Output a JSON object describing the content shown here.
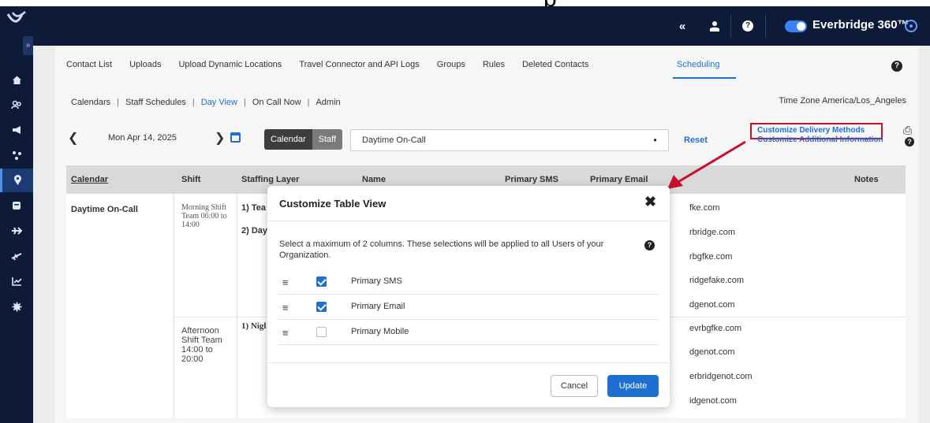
{
  "app": {
    "brand_name": "Everbridge 360™",
    "top_fragment": "p"
  },
  "topbar": {
    "collapse_label": "«",
    "help_label": "?"
  },
  "sidebar": {
    "expand_label": "»",
    "icons": [
      "home-icon",
      "contacts-icon",
      "megaphone-icon",
      "network-icon",
      "location-icon",
      "database-icon",
      "travel-icon",
      "flight-icon",
      "chart-icon",
      "settings-icon"
    ]
  },
  "tabs": [
    {
      "label": "Contact List"
    },
    {
      "label": "Uploads"
    },
    {
      "label": "Upload Dynamic Locations"
    },
    {
      "label": "Travel Connector and API Logs"
    },
    {
      "label": "Groups"
    },
    {
      "label": "Rules"
    },
    {
      "label": "Deleted Contacts"
    },
    {
      "label": "Scheduling"
    }
  ],
  "subnav": {
    "items": [
      "Calendars",
      "Staff Schedules",
      "Day View",
      "On Call Now",
      "Admin"
    ],
    "separator": "|",
    "time_zone": "Time Zone America/Los_Angeles"
  },
  "toolbar": {
    "date": "Mon Apr 14, 2025",
    "view_calendar": "Calendar",
    "view_staff": "Staff",
    "calendar_select": "Daytime On-Call",
    "reset": "Reset",
    "customize_delivery": "Customize Delivery Methods",
    "customize_additional": "Customize Additional Information"
  },
  "table": {
    "headers": {
      "calendar": "Calendar",
      "shift": "Shift",
      "staffing_layer": "Staffing Layer",
      "name": "Name",
      "primary_sms": "Primary SMS",
      "primary_email": "Primary Email",
      "notes": "Notes"
    },
    "calendar_name": "Daytime On-Call",
    "shift1": "Morning Shift Team 06:00 to 14:00",
    "shift2": "Afternoon Shift Team 14:00 to 20:00",
    "layers": [
      "1) Tea",
      "2) Day",
      "1) Nigl"
    ],
    "emails": [
      "fke.com",
      "rbridge.com",
      "rbgfke.com",
      "ridgefake.com",
      "dgenot.com",
      "evrbgfke.com",
      "dgenot.com",
      "erbridgenot.com",
      "idgenot.com"
    ]
  },
  "modal": {
    "title": "Customize Table View",
    "close_label": "✖",
    "description": "Select a maximum of 2 columns. These selections will be applied to all Users of your Organization.",
    "options": [
      {
        "label": "Primary SMS",
        "checked": true
      },
      {
        "label": "Primary Email",
        "checked": true
      },
      {
        "label": "Primary Mobile",
        "checked": false
      }
    ],
    "cancel": "Cancel",
    "update": "Update"
  },
  "colors": {
    "nav_bg": "#0d1b38",
    "accent": "#1f6fd1",
    "highlight_border": "#c8102e"
  }
}
